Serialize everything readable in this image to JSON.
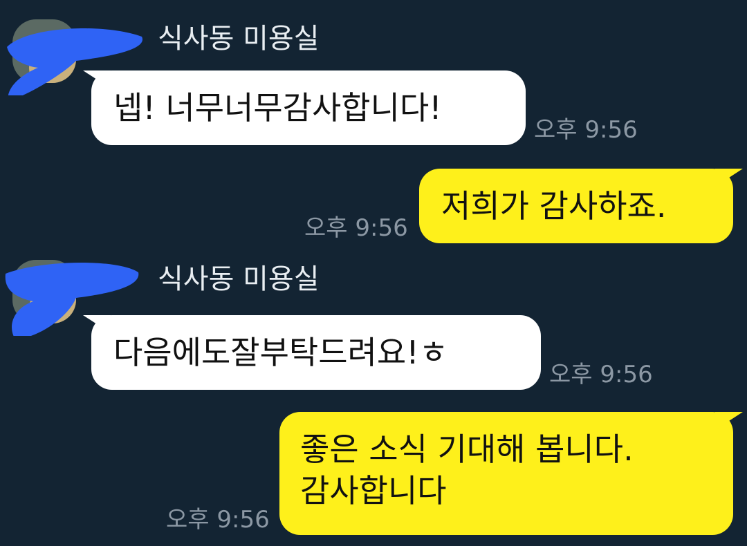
{
  "conversation": {
    "sender_name": "식사동 미용실",
    "messages": [
      {
        "direction": "incoming",
        "text": "넵! 너무너무감사합니다!",
        "time": "오후 9:56"
      },
      {
        "direction": "outgoing",
        "text": "저희가 감사하죠.",
        "time": "오후 9:56"
      },
      {
        "direction": "incoming",
        "text": "다음에도잘부탁드려요!ㅎ",
        "time": "오후 9:56"
      },
      {
        "direction": "outgoing",
        "lines": [
          "좋은 소식 기대해 봅니다.",
          "감사합니다"
        ],
        "time": "오후 9:56"
      }
    ]
  },
  "theme": {
    "background": "#132433",
    "incoming_bubble": "#ffffff",
    "outgoing_bubble": "#fef01b",
    "time_text": "#8c98a4",
    "redaction_scribble": "#2f63f5"
  }
}
